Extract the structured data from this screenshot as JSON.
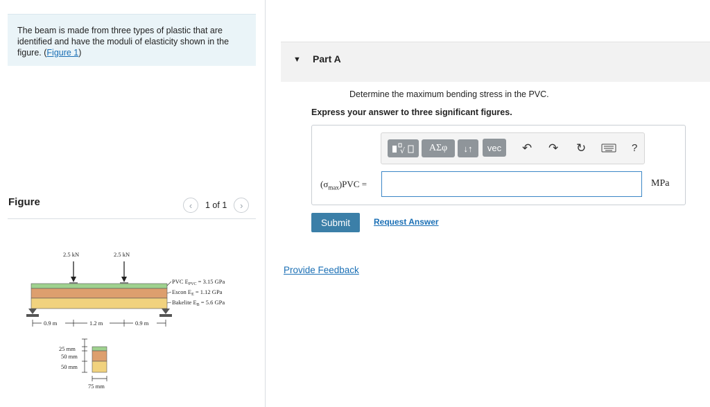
{
  "intro": {
    "text": "The beam is made from three types of plastic that are identified and have the moduli of elasticity shown in the figure.",
    "open_paren": "(",
    "link": "Figure 1",
    "close_paren": ")"
  },
  "figure_panel": {
    "title": "Figure",
    "pager": "1 of 1",
    "prev_icon": "chevron-left-icon",
    "next_icon": "chevron-right-icon"
  },
  "figure": {
    "load_left": "2.5 kN",
    "load_right": "2.5 kN",
    "layer_pvc": "PVC E",
    "layer_pvc_sub": "PVC",
    "layer_pvc_val": " = 3.15 GPa",
    "layer_escon": "Escon E",
    "layer_escon_sub": "E",
    "layer_escon_val": " = 1.12 GPa",
    "layer_bakelite": "Bakelite E",
    "layer_bakelite_sub": "B",
    "layer_bakelite_val": " = 5.6 GPa",
    "dim_left": "0.9 m",
    "dim_mid": "1.2 m",
    "dim_right": "0.9 m",
    "thick_top": "25 mm",
    "thick_mid": "50 mm",
    "thick_bot": "50 mm",
    "width": "75 mm",
    "colors": {
      "pvc": "#9fd18e",
      "escon": "#dd9f6e",
      "bakelite": "#f1d27e"
    }
  },
  "part_a": {
    "title": "Part A",
    "caret_icon": "caret-down-icon",
    "question": "Determine the maximum bending stress in the PVC.",
    "instruction": "Express your answer to three significant figures.",
    "toolbar": {
      "templates_icon": "templates-icon",
      "greek_label": "ΑΣφ",
      "arrows_label": "↓↑",
      "vec_label": "vec",
      "undo_icon": "undo-icon",
      "redo_icon": "redo-icon",
      "reset_icon": "reset-icon",
      "keyboard_icon": "keyboard-icon",
      "help_label": "?"
    },
    "answer_label_open": "(σ",
    "answer_label_sub": "max",
    "answer_label_close": ")PVC =",
    "answer_value": "",
    "unit": "MPa",
    "submit_label": "Submit",
    "request_label": "Request Answer"
  },
  "feedback_label": "Provide Feedback"
}
